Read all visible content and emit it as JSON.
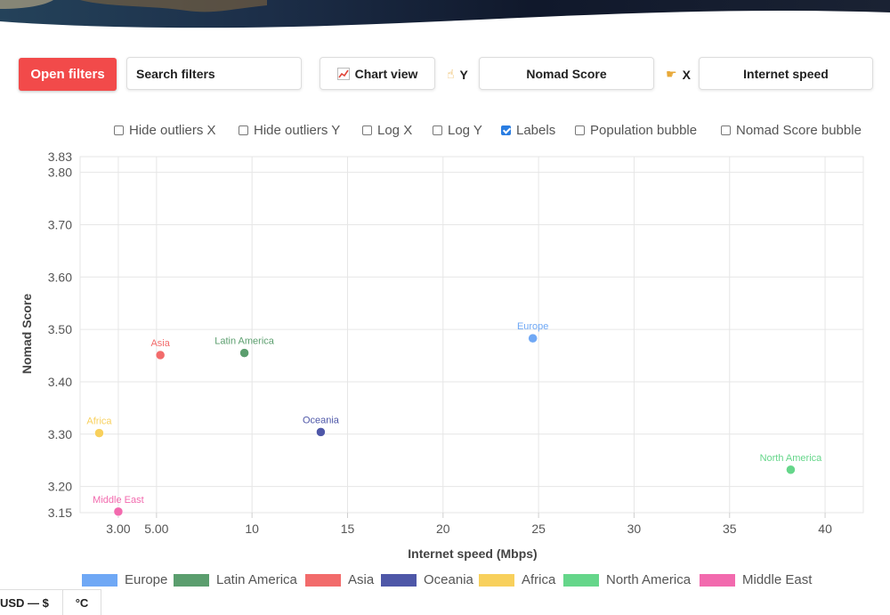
{
  "toolbar": {
    "open_filters": "Open filters",
    "search_placeholder": "Search filters",
    "chart_view_icon": "chart-increasing-icon",
    "chart_view": "Chart view",
    "y_icon": "pointing-up-hand-icon",
    "y_label": "Y",
    "y_value": "Nomad Score",
    "x_icon": "pointing-right-hand-icon",
    "x_label": "X",
    "x_value": "Internet speed"
  },
  "options": [
    {
      "label": "Hide outliers X",
      "checked": false
    },
    {
      "label": "Hide outliers Y",
      "checked": false
    },
    {
      "label": "Log X",
      "checked": false
    },
    {
      "label": "Log Y",
      "checked": false
    },
    {
      "label": "Labels",
      "checked": true
    },
    {
      "label": "Population bubble",
      "checked": false
    },
    {
      "label": "Nomad Score bubble",
      "checked": false
    }
  ],
  "footer": {
    "currency": "USD — $",
    "temperature": "°C"
  },
  "chart_data": {
    "type": "scatter",
    "xlabel": "Internet speed (Mbps)",
    "ylabel": "Nomad Score",
    "xlim": [
      1.0,
      42.0
    ],
    "ylim": [
      3.15,
      3.83
    ],
    "x_ticks": [
      "3.00",
      "5.00",
      "10",
      "15",
      "20",
      "25",
      "30",
      "35",
      "40"
    ],
    "x_tick_values": [
      3,
      5,
      10,
      15,
      20,
      25,
      30,
      35,
      40
    ],
    "y_ticks": [
      "3.83",
      "3.80",
      "3.70",
      "3.60",
      "3.50",
      "3.40",
      "3.30",
      "3.20",
      "3.15"
    ],
    "y_tick_values": [
      3.83,
      3.8,
      3.7,
      3.6,
      3.5,
      3.4,
      3.3,
      3.2,
      3.15
    ],
    "grid": true,
    "show_labels": true,
    "legend_position": "bottom",
    "series": [
      {
        "name": "Europe",
        "color": "#6fa8f5",
        "x": 24.7,
        "y": 3.483
      },
      {
        "name": "Latin America",
        "color": "#5b9e6e",
        "x": 9.6,
        "y": 3.455
      },
      {
        "name": "Asia",
        "color": "#f26b6b",
        "x": 5.2,
        "y": 3.451
      },
      {
        "name": "Oceania",
        "color": "#4e57a8",
        "x": 13.6,
        "y": 3.304
      },
      {
        "name": "Africa",
        "color": "#f8d05c",
        "x": 2.0,
        "y": 3.302
      },
      {
        "name": "North America",
        "color": "#65d68a",
        "x": 38.2,
        "y": 3.232
      },
      {
        "name": "Middle East",
        "color": "#f26aae",
        "x": 3.0,
        "y": 3.152
      }
    ]
  }
}
